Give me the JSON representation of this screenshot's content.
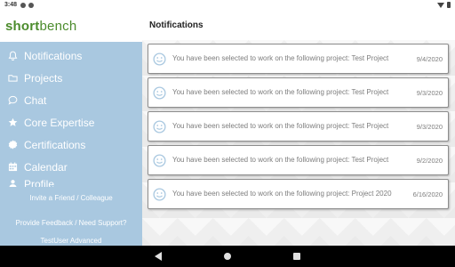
{
  "status_bar": {
    "time": "3:48"
  },
  "brand": {
    "part1": "short",
    "part2": "bench"
  },
  "sidebar": {
    "items": [
      {
        "label": "Notifications",
        "icon": "bell-icon"
      },
      {
        "label": "Projects",
        "icon": "folder-icon"
      },
      {
        "label": "Chat",
        "icon": "chat-icon"
      },
      {
        "label": "Core Expertise",
        "icon": "star-icon"
      },
      {
        "label": "Certifications",
        "icon": "badge-icon"
      },
      {
        "label": "Calendar",
        "icon": "calendar-icon"
      },
      {
        "label": "Profile",
        "icon": "person-icon"
      }
    ],
    "invite_label": "Invite a Friend / Colleague",
    "feedback_label": "Provide Feedback / Need Support?",
    "user_label": "TestUser Advanced"
  },
  "main": {
    "title": "Notifications",
    "notifications": [
      {
        "message": "You have been selected to work on the following project: Test Project",
        "date": "9/4/2020"
      },
      {
        "message": "You have been selected to work on the following project: Test Project",
        "date": "9/3/2020"
      },
      {
        "message": "You have been selected to work on the following project: Test Project",
        "date": "9/3/2020"
      },
      {
        "message": "You have been selected to work on the following project: Test Project",
        "date": "9/2/2020"
      },
      {
        "message": "You have been selected to work on the following project: Project 2020",
        "date": "6/16/2020"
      }
    ]
  },
  "colors": {
    "sidebar_bg": "#a9c8e0",
    "brand_green": "#4c8c2d",
    "card_icon": "#a9c8e0"
  }
}
